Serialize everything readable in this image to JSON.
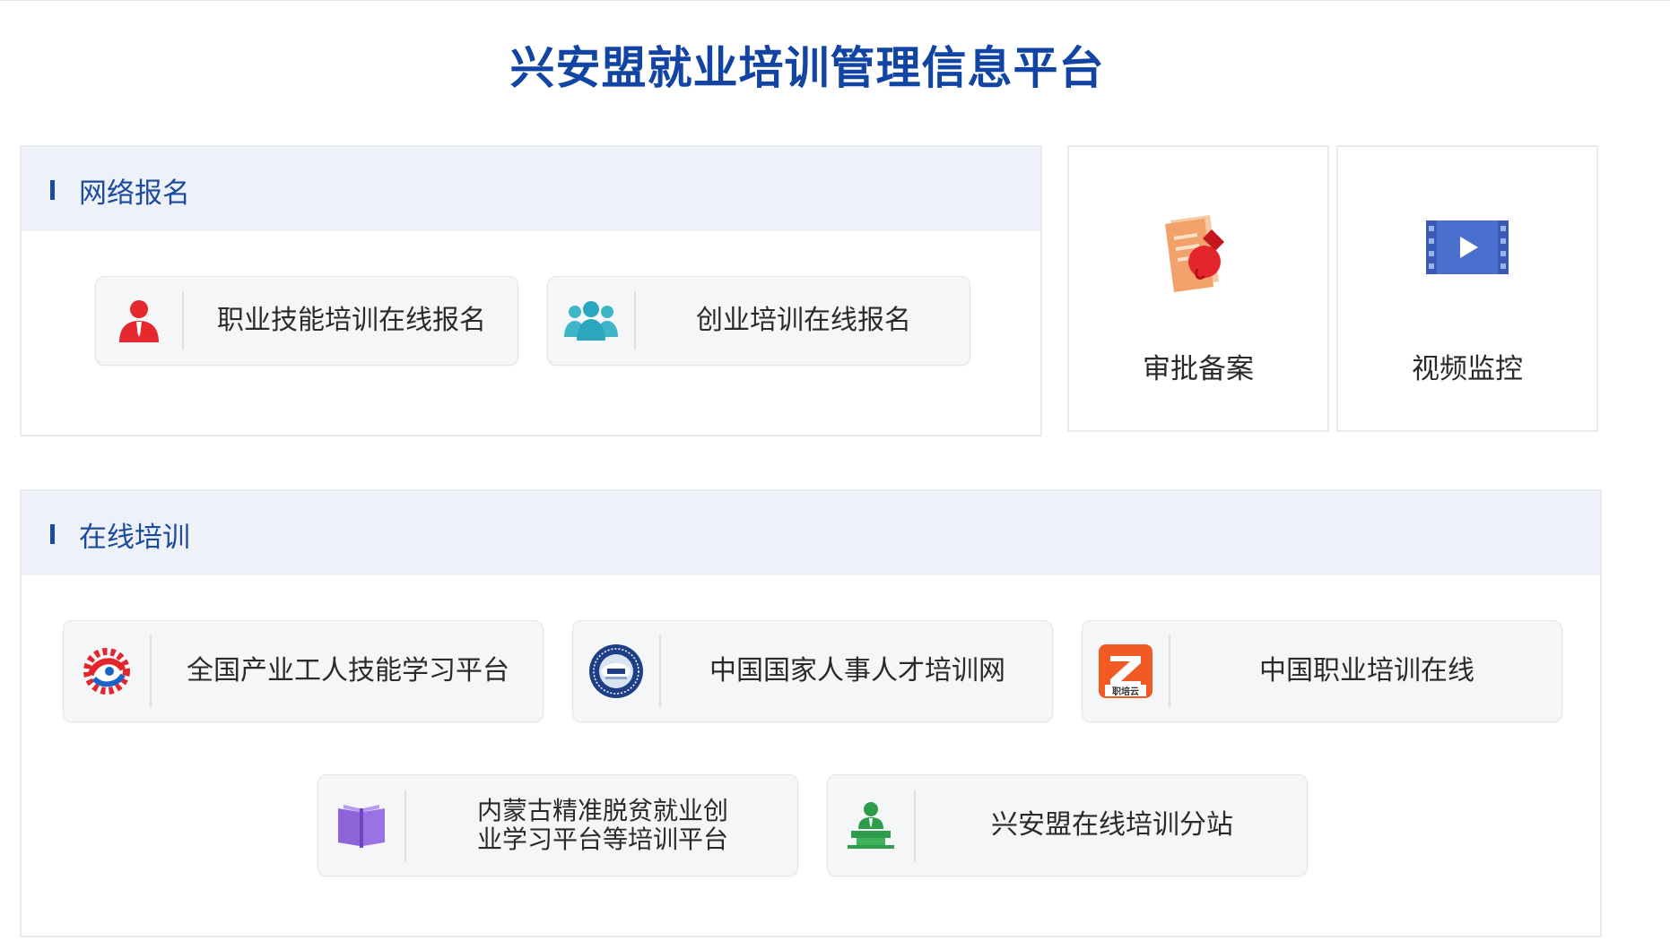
{
  "page": {
    "title": "兴安盟就业培训管理信息平台"
  },
  "registration": {
    "heading": "网络报名",
    "buttons": [
      {
        "label": "职业技能培训在线报名",
        "icon": "person-red-icon"
      },
      {
        "label": "创业培训在线报名",
        "icon": "group-teal-icon"
      }
    ]
  },
  "tiles": [
    {
      "label": "审批备案",
      "icon": "approval-document-icon"
    },
    {
      "label": "视频监控",
      "icon": "video-play-icon"
    }
  ],
  "online_training": {
    "heading": "在线培训",
    "buttons": [
      {
        "label": "全国产业工人技能学习平台",
        "icon": "gear-logo-icon"
      },
      {
        "label": "中国国家人事人才培训网",
        "icon": "seal-logo-icon"
      },
      {
        "label": "中国职业培训在线",
        "icon": "zhipeiyun-logo-icon",
        "logo_text": "职培云"
      },
      {
        "label": "内蒙古精准脱贫就业创业学习平台等培训平台",
        "line1": "内蒙古精准脱贫就业创",
        "line2": "业学习平台等培训平台",
        "icon": "book-icon"
      },
      {
        "label": "兴安盟在线培训分站",
        "icon": "lecturer-icon"
      }
    ]
  },
  "colors": {
    "title": "#1144a3",
    "accent": "#1c4a9c",
    "panel_header_bg": "#eef2f8",
    "button_bg": "#f5f6f8"
  }
}
